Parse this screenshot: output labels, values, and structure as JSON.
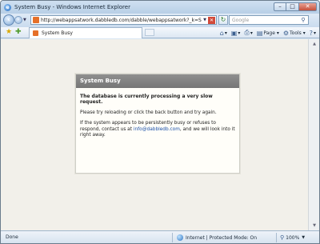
{
  "window": {
    "title": "System Busy - Windows Internet Explorer"
  },
  "navbar": {
    "url": "http://webappsatwork.dabbledb.com/dabble/webappsatwork?_k=SNGIJeTL",
    "search_placeholder": "Google"
  },
  "tab": {
    "label": "System Busy"
  },
  "toolbar": {
    "page_label": "Page",
    "tools_label": "Tools"
  },
  "dialog": {
    "title": "System Busy",
    "headline": "The database is currently processing a very slow request.",
    "line1": "Please try reloading or click the back button and try again.",
    "line2_a": "If the system appears to be persistently busy or refuses to respond, contact us at",
    "email": "info@dabbledb.com",
    "line2_b": ", and we will look into it right away."
  },
  "status": {
    "text": "Done",
    "zone": "Internet | Protected Mode: On",
    "zoom": "100%"
  },
  "colors": {
    "dialog_header": "#7f7f7f",
    "content_bg": "#f2f0ea",
    "link": "#1a4fa8"
  }
}
